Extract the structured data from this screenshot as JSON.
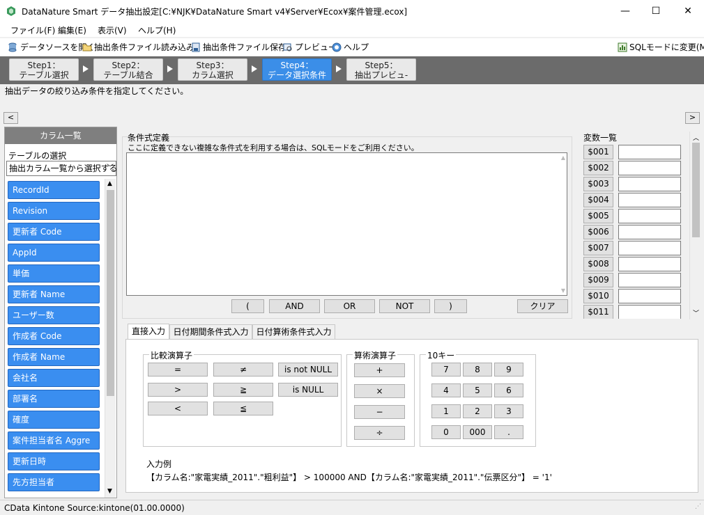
{
  "window": {
    "title": "DataNature Smart データ抽出設定[C:¥NJK¥DataNature Smart v4¥Server¥Ecox¥案件管理.ecox]",
    "minimize": "—",
    "maximize": "☐",
    "close": "✕"
  },
  "menu": [
    "ファイル(F)",
    "編集(E)",
    "表示(V)",
    "ヘルプ(H)"
  ],
  "toolbar": {
    "open_datasource": "データソースを開く",
    "load_conditions": "抽出条件ファイル読み込み",
    "save_conditions": "抽出条件ファイル保存",
    "preview": "プレビュー",
    "help": "ヘルプ",
    "sql_mode": "SQLモードに変更(M)"
  },
  "steps": [
    {
      "line1": "Step1：",
      "line2": "テーブル選択"
    },
    {
      "line1": "Step2：",
      "line2": "テーブル結合"
    },
    {
      "line1": "Step3：",
      "line2": "カラム選択"
    },
    {
      "line1": "Step4：",
      "line2": "データ選択条件"
    },
    {
      "line1": "Step5：",
      "line2": "抽出プレビュ-"
    }
  ],
  "active_step": 4,
  "instruction": "抽出データの絞り込み条件を指定してください。",
  "nav": {
    "prev": "<",
    "next": ">"
  },
  "column_panel": {
    "header": "カラム一覧",
    "table_select_label": "テーブルの選択",
    "table_select_value": "抽出カラム一覧から選択する",
    "columns": [
      "RecordId",
      "Revision",
      "更新者 Code",
      "AppId",
      "単価",
      "更新者 Name",
      "ユーザー数",
      "作成者 Code",
      "作成者 Name",
      "会社名",
      "部署名",
      "確度",
      "案件担当者名 Aggre",
      "更新日時",
      "先方担当者"
    ]
  },
  "condition": {
    "title": "条件式定義",
    "subtitle": "ここに定義できない複雑な条件式を利用する場合は、SQLモードをご利用ください。",
    "text": "",
    "buttons": [
      "(",
      "AND",
      "OR",
      "NOT",
      ")"
    ],
    "clear": "クリア"
  },
  "variables": {
    "title": "変数一覧",
    "items": [
      "$001",
      "$002",
      "$003",
      "$004",
      "$005",
      "$006",
      "$007",
      "$008",
      "$009",
      "$010",
      "$011"
    ]
  },
  "tabs": [
    "直接入力",
    "日付期間条件式入力",
    "日付算術条件式入力"
  ],
  "comparison": {
    "title": "比較演算子",
    "ops": [
      "=",
      "≠",
      "is not NULL",
      ">",
      "≧",
      "is NULL",
      "<",
      "≦"
    ]
  },
  "arithmetic": {
    "title": "算術演算子",
    "ops": [
      "+",
      "×",
      "−",
      "÷"
    ]
  },
  "tenkey": {
    "title": "10キー",
    "keys": [
      "7",
      "8",
      "9",
      "4",
      "5",
      "6",
      "1",
      "2",
      "3",
      "0",
      "000",
      "."
    ]
  },
  "example": {
    "title": "入力例",
    "text": "【カラム名:\"家電実績_2011\".\"粗利益\"】 > 100000 AND【カラム名:\"家電実績_2011\".\"伝票区分\"】 =  '1'"
  },
  "status": "CData Kintone Source:kintone(01.00.0000)",
  "colors": {
    "accent": "#3a8ef0",
    "step_bar": "#6b6b6b",
    "active_step": "#3b8ee8"
  }
}
